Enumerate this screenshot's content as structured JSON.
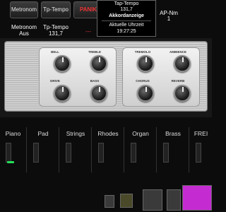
{
  "top": {
    "buttons": [
      {
        "label": "Metronom"
      },
      {
        "label": "Tp-Tempo"
      },
      {
        "label": "PANIK"
      }
    ],
    "metronom_label": "Metronom",
    "metronom_value": "Aus",
    "tempo_label": "Tp-Tempo",
    "tempo_value": "131,7",
    "panic_value": "---",
    "display": {
      "line1": "Tap-Tempo",
      "line2": "131,7",
      "line3": "Akkordanzeige",
      "line4": "Aktuelle Uhrzeit",
      "line5": "19:27:25"
    },
    "ap_label": "AP-Nm",
    "ap_value": "1"
  },
  "amp": {
    "left_knobs": [
      "BELL",
      "TREBLE",
      "DRIVE",
      "BASS"
    ],
    "right_knobs": [
      "TREMOLO",
      "AMBIENCE",
      "CHORUS",
      "REVERB"
    ]
  },
  "slots": [
    {
      "name": "Piano",
      "active": true
    },
    {
      "name": "Pad",
      "active": false
    },
    {
      "name": "Strings",
      "active": false
    },
    {
      "name": "Rhodes",
      "active": false
    },
    {
      "name": "Organ",
      "active": false
    },
    {
      "name": "Brass",
      "active": false
    },
    {
      "name": "FREI",
      "active": false
    }
  ],
  "colors": {
    "background": "#0c0c0c",
    "panic": "#e33333",
    "led": "#25e05a",
    "keyboard": "#c42bd0"
  },
  "icons": [
    "speaker-icon",
    "save-icon",
    "fader-icon",
    "keyboard-icon"
  ]
}
